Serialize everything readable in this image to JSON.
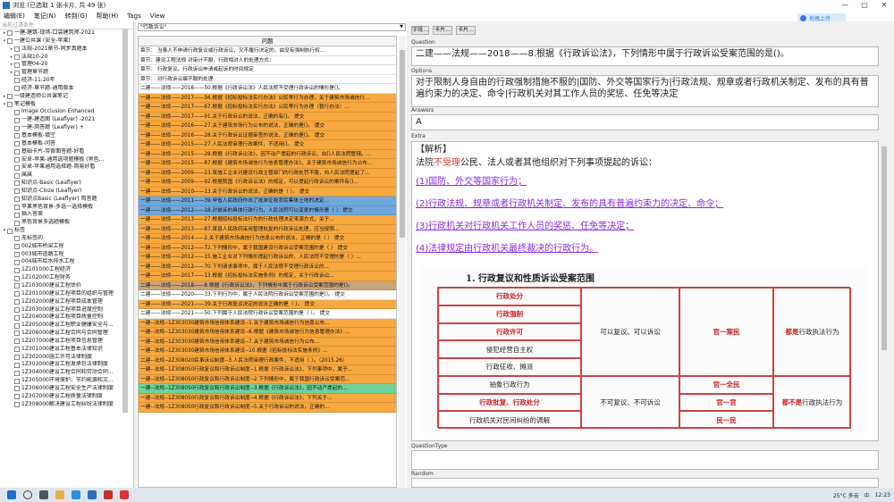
{
  "window": {
    "title": "浏览 (已选取 1 张卡片, 共 49 张)",
    "minimize_icon": "—",
    "maximize_icon": "▢",
    "close_icon": "✕"
  },
  "menu": [
    "编辑(E)",
    "笔记(N)",
    "转到(G)",
    "帮助(H)",
    "Tags",
    "View"
  ],
  "cloud_button": "拖拽上传",
  "left_panel": {
    "search_placeholder": "当前过滤条件",
    "items": [
      {
        "label": "一建-建筑-现场-口袋建筑师-2021",
        "depth": 0,
        "arrow": "▸",
        "checkbox": true
      },
      {
        "label": "一建公共课 (安全-苹果)",
        "depth": 0,
        "arrow": "▾",
        "checkbox": true
      },
      {
        "label": "法规-2021章节-同步真题本",
        "depth": 1,
        "arrow": "▸",
        "checkbox": true
      },
      {
        "label": "法规10-20",
        "depth": 1,
        "arrow": "▸",
        "checkbox": true
      },
      {
        "label": "管理04-20",
        "depth": 1,
        "arrow": "▸",
        "checkbox": true
      },
      {
        "label": "管理章节题",
        "depth": 1,
        "arrow": "▸",
        "checkbox": true
      },
      {
        "label": "经济-11-20年",
        "depth": 1,
        "arrow": "",
        "checkbox": true
      },
      {
        "label": "经济-章节题-通用版本",
        "depth": 1,
        "arrow": "",
        "checkbox": true
      },
      {
        "label": "一级建造师公共课笔记",
        "depth": 0,
        "arrow": "▸",
        "checkbox": true
      },
      {
        "label": "笔记模板",
        "depth": 0,
        "arrow": "▾",
        "checkbox": true
      },
      {
        "label": "Image Occlusion Enhanced",
        "depth": 1,
        "arrow": "",
        "checkbox": true
      },
      {
        "label": "一建-建造图 (Leaflyer) -2021",
        "depth": 1,
        "arrow": "",
        "checkbox": true
      },
      {
        "label": "一建-简答题 (Leaflyer) +",
        "depth": 1,
        "arrow": "",
        "checkbox": true
      },
      {
        "label": "基本模板-填空",
        "depth": 1,
        "arrow": "",
        "checkbox": true
      },
      {
        "label": "基本模板-问答",
        "depth": 1,
        "arrow": "",
        "checkbox": true
      },
      {
        "label": "基础卡片-带背面答题-好看",
        "depth": 1,
        "arrow": "",
        "checkbox": true
      },
      {
        "label": "安卓-苹果-通用选项题模板 (黑色...",
        "depth": 1,
        "arrow": "",
        "checkbox": true
      },
      {
        "label": "安卓-苹果通用选择题-简易好看",
        "depth": 1,
        "arrow": "",
        "checkbox": true
      },
      {
        "label": "属属",
        "depth": 1,
        "arrow": "",
        "checkbox": true
      },
      {
        "label": "知识点-Basic (Leaflyer)",
        "depth": 1,
        "arrow": "",
        "checkbox": true
      },
      {
        "label": "知识点-Cloze (Leaflyer)",
        "depth": 1,
        "arrow": "",
        "checkbox": true
      },
      {
        "label": "知识点Basic (Leaflyer) 简答题",
        "depth": 1,
        "arrow": "",
        "checkbox": true
      },
      {
        "label": "苹果黑色背景-多选一选择模板",
        "depth": 1,
        "arrow": "",
        "checkbox": true
      },
      {
        "label": "插入答案",
        "depth": 1,
        "arrow": "",
        "checkbox": true
      },
      {
        "label": "黑色背景多选题模板",
        "depth": 1,
        "arrow": "",
        "checkbox": true
      },
      {
        "label": "标签",
        "depth": 0,
        "arrow": "▾",
        "checkbox": true
      },
      {
        "label": "无标签的",
        "depth": 1,
        "arrow": "",
        "checkbox": true
      },
      {
        "label": "002城市桥梁工程",
        "depth": 1,
        "arrow": "",
        "checkbox": true
      },
      {
        "label": "003城市道路工程",
        "depth": 1,
        "arrow": "",
        "checkbox": true
      },
      {
        "label": "004城市给水排水工程",
        "depth": 1,
        "arrow": "",
        "checkbox": true
      },
      {
        "label": "1Z101000工程经济",
        "depth": 1,
        "arrow": "",
        "checkbox": true
      },
      {
        "label": "1Z102000工程财务",
        "depth": 1,
        "arrow": "",
        "checkbox": true
      },
      {
        "label": "1Z103000建设工程估价",
        "depth": 1,
        "arrow": "",
        "checkbox": true
      },
      {
        "label": "1Z201000建设工程项目的组织与管理",
        "depth": 1,
        "arrow": "",
        "checkbox": true
      },
      {
        "label": "1Z202000建设工程项目成本管理",
        "depth": 1,
        "arrow": "",
        "checkbox": true
      },
      {
        "label": "1Z203000建设工程项目进度控制",
        "depth": 1,
        "arrow": "",
        "checkbox": true
      },
      {
        "label": "1Z204000建设工程项目质量控制",
        "depth": 1,
        "arrow": "",
        "checkbox": true
      },
      {
        "label": "1Z205000建设工程职业健康安全与...",
        "depth": 1,
        "arrow": "",
        "checkbox": true
      },
      {
        "label": "1Z206000建设工程合同与合同管理",
        "depth": 1,
        "arrow": "",
        "checkbox": true
      },
      {
        "label": "1Z207000建设工程项目信息管理",
        "depth": 1,
        "arrow": "",
        "checkbox": true
      },
      {
        "label": "1Z301000建设工程基本法律知识",
        "depth": 1,
        "arrow": "",
        "checkbox": true
      },
      {
        "label": "1Z302000施工许可法律制度",
        "depth": 1,
        "arrow": "",
        "checkbox": true
      },
      {
        "label": "1Z303000建设工程发承包法律制度",
        "depth": 1,
        "arrow": "",
        "checkbox": true
      },
      {
        "label": "1Z304000建设工程合同和劳动合同...",
        "depth": 1,
        "arrow": "",
        "checkbox": true
      },
      {
        "label": "1Z305000环境保护、节约能源和文...",
        "depth": 1,
        "arrow": "",
        "checkbox": true
      },
      {
        "label": "1Z306000建设工程安全生产法律制度",
        "depth": 1,
        "arrow": "",
        "checkbox": true
      },
      {
        "label": "1Z307000建设工程质量法律制度",
        "depth": 1,
        "arrow": "",
        "checkbox": true
      },
      {
        "label": "1Z308000解决建设工程纠纷法律制度",
        "depth": 1,
        "arrow": "",
        "checkbox": true
      }
    ]
  },
  "middle_panel": {
    "search_value": "\"行政诉讼\"",
    "column_header": "问题",
    "rows": [
      {
        "text": "章节：    当事人不申请行政复议或行政诉讼，又不履行决定的，由没有强制执行权...",
        "color": "#ffffff"
      },
      {
        "text": "章节：建设工程法规    对审计不服，行政相对人的处理方式：",
        "color": "#ffffff"
      },
      {
        "text": "章节：    行政复议、行政诉讼申请或起诉的时间规定",
        "color": "#ffffff"
      },
      {
        "text": "章节：    对行政诉讼编不服的处理",
        "color": "#ffffff"
      },
      {
        "text": "二建——法规——2018——50.根据《行政诉讼法》人民法院不受理行政诉讼的情形是()。",
        "color": "#ffffff"
      },
      {
        "text": "一建——法规——2017——56.根据《招标投标法实行办法》公民等行为办理，关于建筑市场诚信行...",
        "color": "#f7a83e"
      },
      {
        "text": "一建——法规——2017——67.根据《招标投标法实行办法》公民等行为办理（暂行办法）...",
        "color": "#f7a83e"
      },
      {
        "text": "一建——法规——2017——91.关于行政诉讼的说法，正确的有()。    提交",
        "color": "#f7a83e"
      },
      {
        "text": "一建——法规——2016——27.关于建筑市场行为公布的说法，正确的是()。    提交",
        "color": "#f7a83e"
      },
      {
        "text": "一建——法规——2016——28.关于行政诉讼证据审查的说法，正确的是()。    提交",
        "color": "#f7a83e"
      },
      {
        "text": "一建——法规——2015——27.人民法院审理行政案件，不适用()。    提交",
        "color": "#f7a83e"
      },
      {
        "text": "一建——法规——2015——28.根据《行政诉讼法》，因不动产提起的行政诉讼，由()人民法院管辖。...",
        "color": "#f7a83e"
      },
      {
        "text": "一建——法规——2015——87.根据《建筑市场诚信行为信息管理办法》，关于建筑市场诚信行为公布...",
        "color": "#f7a83e"
      },
      {
        "text": "一建——法规——2009——23.某施工企业对建设行政主管部门的行政处罚不服，向人民法院提起了...",
        "color": "#f7a83e"
      },
      {
        "text": "一建——法规——2009——92.根据我国《行政诉讼法》的规定，可以提起行政诉讼的案件有()...",
        "color": "#f7a83e"
      },
      {
        "text": "一建——法规——2010——13.关于行政诉讼的说法，正确的是（ ）。    提交",
        "color": "#f7a83e"
      },
      {
        "text": "一建——法规——2011——39.甲省人民政府作出了批准征收农民集体土地的决定...",
        "color": "#6fa8dc"
      },
      {
        "text": "一建——法规——2012——18.对被诉的具体行政行为，人民法院可以变更的情形是（ ）    提交",
        "color": "#6fa8dc"
      },
      {
        "text": "一建——法规——2013——27.根据招标投标法行为的行政处理决定来源方式，关于...",
        "color": "#f7a83e"
      },
      {
        "text": "一建——法规——2013——87.某县人民政府采用管理批复的行政诉讼处理，应当按照...",
        "color": "#f7a83e"
      },
      {
        "text": "一建——法规——2014——2.关于建筑市场诚信行为信息公布的说法，正确的是（ ）    提交",
        "color": "#f7a83e"
      },
      {
        "text": "一建——法规——2012——72.下列情形中，属于我国建设行政诉讼受案范围的是（ ）    提交",
        "color": "#f7a83e"
      },
      {
        "text": "一建——法规——2012——15.施工企业对下列情形提起行政诉讼的，人民法院不受理的是（ ）...",
        "color": "#f7a83e"
      },
      {
        "text": "一建——法规——2012——70.下列请求事项中，属于人民法院不受理行政诉讼的...",
        "color": "#f7a83e"
      },
      {
        "text": "一建——法规——2017——13.根据《招标投标法实施条例》的规定，关于行政诉讼...",
        "color": "#f7a83e"
      },
      {
        "text": "二建——法规——2018——8.根据《行政诉讼法》，下列情形中属于行政诉讼受案范围的是()。",
        "color": "#c9a57a"
      },
      {
        "text": "二建——法规——2020——33.下列行为中，属于人民法院行政诉讼受案范围的是()。    提交",
        "color": "#ffffff"
      },
      {
        "text": "一建——法规——2021——39.关于行政复议决定的说法正确的是（ ）。    提交",
        "color": "#f7a83e"
      },
      {
        "text": "二建——法规——2021——50.下列属于人民法院行政诉讼受案范围的是（ ）。    提交",
        "color": "#ffffff"
      },
      {
        "text": "一建--法规--1Z303030建筑市场信用体系建设--1.关于建筑市场诚信行为信息公布...",
        "color": "#f7a83e"
      },
      {
        "text": "一建--法规--1Z303030建筑市场信用体系建设--6.根据《建筑市场诚信行为信息管理办法》...",
        "color": "#f7a83e"
      },
      {
        "text": "一建--法规--1Z303030建筑市场信用体系建设--7.关于建筑市场诚信行为公布...",
        "color": "#f7a83e"
      },
      {
        "text": "一建--法规--1Z303030建筑市场信用体系建设--10.根据《招标投标法实施条例》...",
        "color": "#f7a83e"
      },
      {
        "text": "二建--法规--2Z308020民事诉讼制度--3.人民法院审理行政案件，不适用（ ）。（2015.26）",
        "color": "#f7a83e"
      },
      {
        "text": "一建--法规--1Z308050行政复议和行政诉讼制度--1.根据《行政诉讼法》，下列事项中，属于...",
        "color": "#f7a83e"
      },
      {
        "text": "一建--法规--1Z308050行政复议和行政诉讼制度--2.下列情形中，属于我国行政诉讼受案范...",
        "color": "#f7a83e"
      },
      {
        "text": "一建--法规--1Z308050行政复议和行政诉讼制度--3.根据《行政诉讼法》，因不动产提起的...",
        "color": "#6ed39b"
      },
      {
        "text": "一建--法规--1Z308050行政复议和行政诉讼制度--4.根据《行政诉讼法》，下列关于...",
        "color": "#f7a83e"
      },
      {
        "text": "一建--法规--1Z308050行政复议和行政诉讼制度--5.关于行政诉讼的说法，正确的...",
        "color": "#f7a83e"
      }
    ]
  },
  "right_panel": {
    "buttons": [
      "字段...",
      "卡片...",
      "卡片..."
    ],
    "question_label": "Question",
    "question_text": "二建——法规——2018——8.根据《行政诉讼法》，下列情形中属于行政诉讼受案范围的是()。",
    "options_label": "Options",
    "options_text": "对于限制人身自由的行政强制措施不服的|国防、外交等国家行为|行政法规、规章或者行政机关制定、发布的具有普遍约束力的决定、命令|行政机关对其工作人员的奖惩、任免等决定",
    "answers_label": "Answers",
    "answers_text": "A",
    "extra_label": "Extra",
    "extra": {
      "heading": "【解析】",
      "intro_prefix": "法院",
      "intro_highlight": "不受理",
      "intro_suffix": "公民、法人或者其他组织对下列事项提起的诉讼：",
      "items": [
        "(1)国防、外交等国家行为；",
        "(2)行政法规、规章或者行政机关制定、发布的具有普遍约束力的决定、命令；",
        "(3)行政机关对行政机关工作人员的奖惩、任免等决定；",
        "(4)法律规定由行政机关最终裁决的行政行为。"
      ],
      "figure_title": "1. 行政复议和性质诉讼受案范围",
      "figure_rows": {
        "col1": [
          "行政处分",
          "行政强制",
          "行政许可",
          "侵犯经营自主权",
          "行政征收、摊派",
          "抽象行政行为",
          "行政批复、行政处分",
          "行政机关对民间纠纷的调解"
        ],
        "col2a": "可以复议、可以诉讼",
        "col2b": "不可复议、不可诉讼",
        "col3a": "官一案民",
        "col3b": [
          "官一全民",
          "官一官",
          "民一民"
        ],
        "col4a": "都是行政执法行为",
        "col4b": "都不是行政执法行为"
      }
    },
    "question_type_label": "QuestionType",
    "random_label": "Random"
  },
  "taskbar": {
    "weather": "25°C 多云",
    "ime": "中",
    "time": "12:23"
  },
  "colors": {
    "accent_orange": "#f7a83e",
    "accent_blue": "#6fa8dc",
    "link_purple": "#8a2be2",
    "highlight_red": "#e23b3b"
  }
}
